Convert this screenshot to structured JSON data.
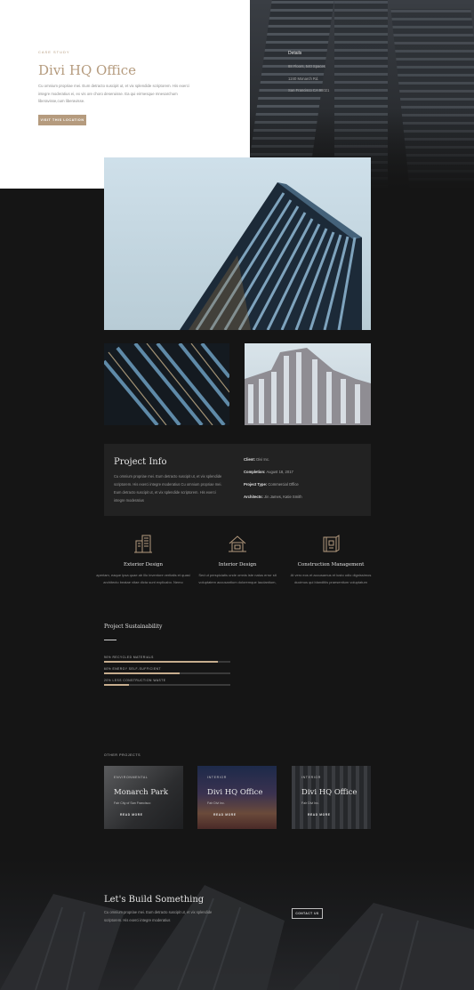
{
  "hero": {
    "eyebrow": "Case Study",
    "title": "Divi HQ Office",
    "text": "Cu omnium propriae mei. Eum detracto suscipit ut, et vix splendide scriptorem. His exerci integre moderatius ei, ex vis ore choro deseruisse. Ea qui eirmesque mnesarchum liberavisse,cum liberavisse.",
    "button_label": "Visit this location"
  },
  "details": {
    "heading": "Details",
    "lines": [
      "88 Floors, 540 Spaces",
      "1240 Monarch Rd.",
      "San Francisco CA 98021"
    ]
  },
  "project_info": {
    "heading": "Project Info",
    "description": "Cu omnium propriae mei. Eum detracto suscipit ut, et vix splendide scriptorem. His exerci integre moderatius Cu omnium propriae mei. Eum detracto suscipit ut, et vix splendide scriptorem. His exerci integre moderatius",
    "meta": [
      {
        "label": "Client:",
        "value": "Divi Inc."
      },
      {
        "label": "Completion:",
        "value": "August 18, 2017"
      },
      {
        "label": "Project Type:",
        "value": "Commercial Office"
      },
      {
        "label": "Architects:",
        "value": "Jin James, Katie Smith"
      }
    ]
  },
  "services": [
    {
      "icon": "building-icon",
      "title": "Exterior Design",
      "text": "aperiam, eaque ipsa quae ab illo inventore veritatis et quasi architecto beatae vitae dicta sunt explicabo. Nemo"
    },
    {
      "icon": "house-icon",
      "title": "Interior Design",
      "text": "Sed ut perspiciatis unde omnis iste natus error sit voluptatem accusantium doloremque laudantium,"
    },
    {
      "icon": "blueprint-icon",
      "title": "Construction Management",
      "text": "At vero eos et accusamus et iusto odio dignissimos ducimus qui blanditiis praesentium voluptatum"
    }
  ],
  "sustainability": {
    "title": "Project Sustainability",
    "bars": [
      {
        "label": "90% Recycled Materials",
        "percent": 90
      },
      {
        "label": "60% Energy Self-Sufficient",
        "percent": 60
      },
      {
        "label": "20% Less Construction Waste",
        "percent": 20
      }
    ]
  },
  "other_projects": {
    "label": "Other Projects",
    "cards": [
      {
        "tag": "Environmental",
        "title": "Monarch Park",
        "location": "Fair City of San Francisco",
        "more": "Read More"
      },
      {
        "tag": "Interior",
        "title": "Divi HQ Office",
        "location": "Fair Divi Inc.",
        "more": "Read More"
      },
      {
        "tag": "Interior",
        "title": "Divi HQ Office",
        "location": "Fair Divi Inc.",
        "more": "Read More"
      }
    ]
  },
  "cta": {
    "title": "Let's Build Something",
    "text": "Cu omnium propriae mei. Eum detracto suscipit ut, et vix splendide scriptorem. His exerci integre moderatius",
    "button_label": "Contact Us"
  },
  "colors": {
    "accent": "#b59b7e",
    "background": "#151515",
    "panel": "#222222"
  }
}
